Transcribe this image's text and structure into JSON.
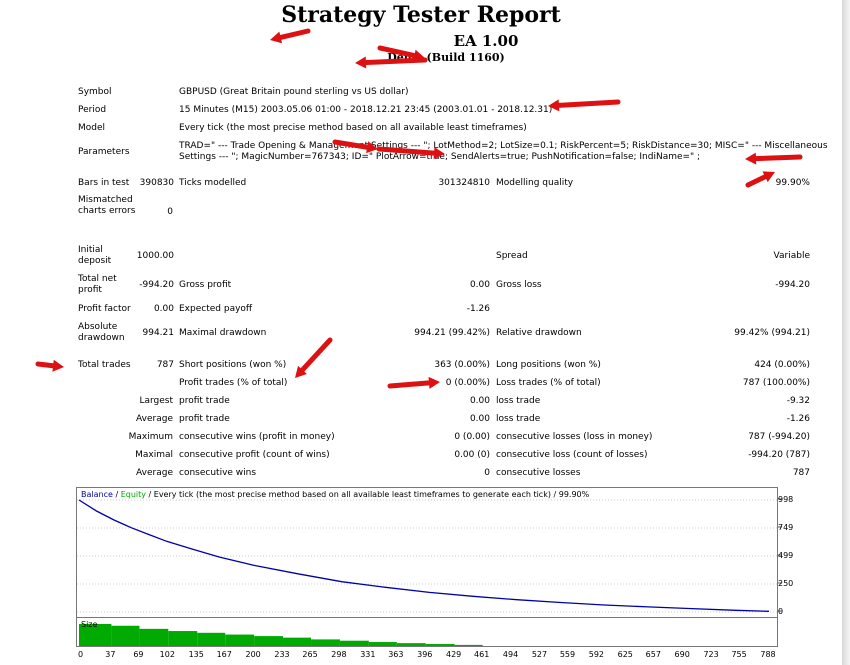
{
  "header": {
    "title": "Strategy Tester Report",
    "ea_name": "EA 1.00",
    "server": "Demo (Build 1160)"
  },
  "rows": {
    "symbol": {
      "label": "Symbol",
      "value": "GBPUSD (Great Britain pound sterling vs US dollar)"
    },
    "period": {
      "label": "Period",
      "value": "15 Minutes (M15) 2003.05.06 01:00 - 2018.12.21 23:45 (2003.01.01 - 2018.12.31)"
    },
    "model": {
      "label": "Model",
      "value": "Every tick (the most precise method based on all available least timeframes)"
    },
    "parameters": {
      "label": "Parameters",
      "line1": "TRAD=\" --- Trade Opening & Management Settings --- \"; LotMethod=2; LotSize=0.1; RiskPercent=5; RiskDistance=30; MISC=\" --- Miscellaneous",
      "line2": "Settings --- \"; MagicNumber=767343; ID=\"                    PlotArrow=true; SendAlerts=true; PushNotification=false; IndiName=\"               ;"
    },
    "bars": {
      "label": "Bars in test",
      "value": "390830",
      "ticks_label": "Ticks modelled",
      "ticks_value": "301324810",
      "quality_label": "Modelling quality",
      "quality_value": "99.90%"
    },
    "mismatch": {
      "label": "Mismatched charts errors",
      "value": "0"
    },
    "deposit": {
      "label": "Initial deposit",
      "value": "1000.00",
      "spread_label": "Spread",
      "spread_value": "Variable"
    },
    "netprofit": {
      "label": "Total net profit",
      "value": "-994.20",
      "gp_label": "Gross profit",
      "gp_value": "0.00",
      "gl_label": "Gross loss",
      "gl_value": "-994.20"
    },
    "pf": {
      "label": "Profit factor",
      "value": "0.00",
      "ep_label": "Expected payoff",
      "ep_value": "-1.26"
    },
    "dd": {
      "label": "Absolute drawdown",
      "value": "994.21",
      "md_label": "Maximal drawdown",
      "md_value": "994.21 (99.42%)",
      "rd_label": "Relative drawdown",
      "rd_value": "99.42% (994.21)"
    },
    "trades": {
      "label": "Total trades",
      "value": "787",
      "sp_label": "Short positions (won %)",
      "sp_value": "363 (0.00%)",
      "lp_label": "Long positions (won %)",
      "lp_value": "424 (0.00%)"
    },
    "pt": {
      "pt_label": "Profit trades (% of total)",
      "pt_value": "0 (0.00%)",
      "lt_label": "Loss trades (% of total)",
      "lt_value": "787 (100.00%)"
    },
    "largest": {
      "label": "Largest",
      "a_label": "profit trade",
      "a_value": "0.00",
      "b_label": "loss trade",
      "b_value": "-9.32"
    },
    "average": {
      "label": "Average",
      "a_label": "profit trade",
      "a_value": "0.00",
      "b_label": "loss trade",
      "b_value": "-1.26"
    },
    "maximum": {
      "label": "Maximum",
      "a_label": "consecutive wins (profit in money)",
      "a_value": "0 (0.00)",
      "b_label": "consecutive losses (loss in money)",
      "b_value": "787 (-994.20)"
    },
    "maximal": {
      "label": "Maximal",
      "a_label": "consecutive profit (count of wins)",
      "a_value": "0.00 (0)",
      "b_label": "consecutive loss (count of losses)",
      "b_value": "-994.20 (787)"
    },
    "average2": {
      "label": "Average",
      "a_label": "consecutive wins",
      "a_value": "0",
      "b_label": "consecutive losses",
      "b_value": "787"
    }
  },
  "chart_data": {
    "type": "line",
    "legend": {
      "balance": "Balance",
      "sep1": " / ",
      "equity": "Equity",
      "rest": " / Every tick (the most precise method based on all available least timeframes to generate each tick) / 99.90%"
    },
    "y_ticks": [
      "998",
      "749",
      "499",
      "250",
      "0"
    ],
    "ylim": [
      0,
      998
    ],
    "x_ticks": [
      "0",
      "37",
      "69",
      "102",
      "135",
      "167",
      "200",
      "233",
      "265",
      "298",
      "331",
      "363",
      "396",
      "429",
      "461",
      "494",
      "527",
      "559",
      "592",
      "625",
      "657",
      "690",
      "723",
      "755",
      "788"
    ],
    "xlim": [
      0,
      788
    ],
    "balance_color": "#0000aa",
    "equity_color": "#00aa00",
    "series": [
      {
        "name": "Balance",
        "x": [
          0,
          20,
          40,
          60,
          80,
          100,
          130,
          160,
          200,
          250,
          300,
          350,
          400,
          450,
          500,
          550,
          600,
          650,
          700,
          750,
          788
        ],
        "values": [
          998,
          900,
          820,
          750,
          690,
          630,
          560,
          490,
          415,
          340,
          270,
          220,
          175,
          140,
          110,
          85,
          62,
          45,
          30,
          15,
          6
        ]
      }
    ],
    "size_label": "Size",
    "size_color": "#00aa00",
    "size_blocks": [
      {
        "x0": 0,
        "x1": 37,
        "v": 1.0
      },
      {
        "x0": 37,
        "x1": 69,
        "v": 0.92
      },
      {
        "x0": 69,
        "x1": 102,
        "v": 0.78
      },
      {
        "x0": 102,
        "x1": 135,
        "v": 0.68
      },
      {
        "x0": 135,
        "x1": 167,
        "v": 0.6
      },
      {
        "x0": 167,
        "x1": 200,
        "v": 0.52
      },
      {
        "x0": 200,
        "x1": 233,
        "v": 0.45
      },
      {
        "x0": 233,
        "x1": 265,
        "v": 0.38
      },
      {
        "x0": 265,
        "x1": 298,
        "v": 0.3
      },
      {
        "x0": 298,
        "x1": 331,
        "v": 0.24
      },
      {
        "x0": 331,
        "x1": 363,
        "v": 0.18
      },
      {
        "x0": 363,
        "x1": 396,
        "v": 0.13
      },
      {
        "x0": 396,
        "x1": 429,
        "v": 0.09
      },
      {
        "x0": 429,
        "x1": 461,
        "v": 0.05
      }
    ]
  },
  "annotation": {
    "arrow_color": "#dd1111"
  }
}
